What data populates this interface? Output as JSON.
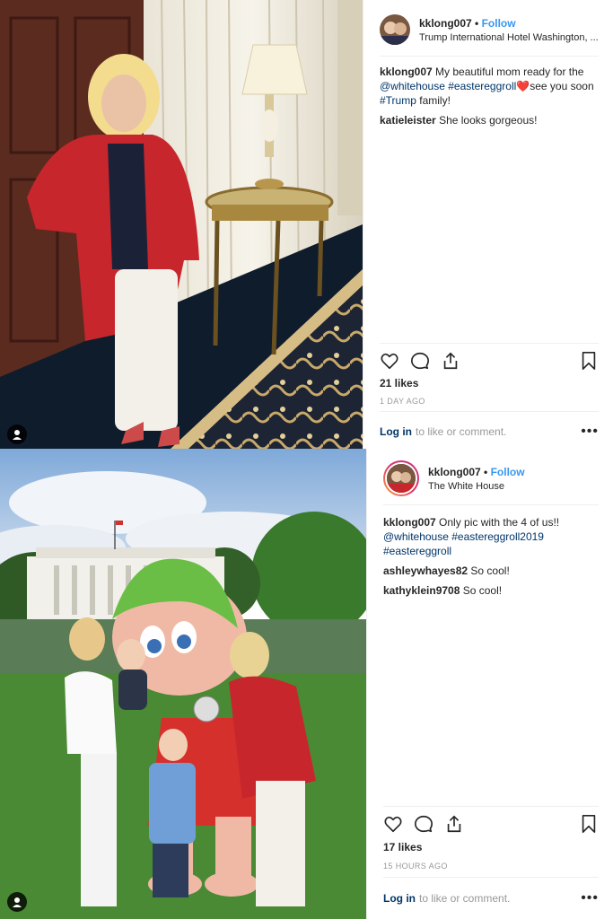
{
  "posts": [
    {
      "username": "kklong007",
      "separator": "•",
      "follow_label": "Follow",
      "location": "Trump International Hotel Washington, ...",
      "caption": {
        "user": "kklong007",
        "text_before": "My beautiful mom ready for the",
        "tag1": "@whitehouse",
        "tag2": "#eastereggroll",
        "emoji": "❤️",
        "text_after": "see you soon",
        "tag3": "#Trump",
        "text_end": "family!"
      },
      "comments": [
        {
          "user": "katieleister",
          "text": "She looks gorgeous!"
        }
      ],
      "likes": "21 likes",
      "time": "1 DAY AGO",
      "login_link": "Log in",
      "login_text": "to like or comment.",
      "more": "•••"
    },
    {
      "username": "kklong007",
      "separator": "•",
      "follow_label": "Follow",
      "location": "The White House",
      "caption": {
        "user": "kklong007",
        "text_before": "Only pic with the 4 of us!!",
        "tag1": "@whitehouse",
        "tag2": "#eastereggroll2019",
        "tag3": "#eastereggroll"
      },
      "comments": [
        {
          "user": "ashleywhayes82",
          "text": "So cool!"
        },
        {
          "user": "kathyklein9708",
          "text": "So cool!"
        }
      ],
      "likes": "17 likes",
      "time": "15 HOURS AGO",
      "login_link": "Log in",
      "login_text": "to like or comment.",
      "more": "•••"
    }
  ],
  "colors": {
    "link": "#003569",
    "follow": "#3897f0",
    "muted": "#999999",
    "heart": "#ed4956"
  },
  "icons": [
    "heart-icon",
    "comment-icon",
    "share-icon",
    "bookmark-icon",
    "user-tag-icon",
    "more-options-icon"
  ]
}
